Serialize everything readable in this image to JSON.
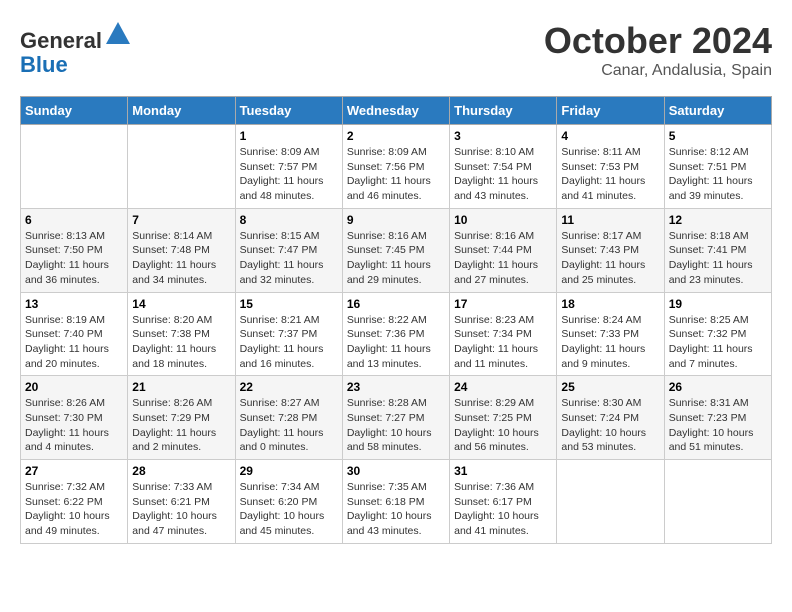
{
  "header": {
    "logo_line1": "General",
    "logo_line2": "Blue",
    "month": "October 2024",
    "location": "Canar, Andalusia, Spain"
  },
  "days_of_week": [
    "Sunday",
    "Monday",
    "Tuesday",
    "Wednesday",
    "Thursday",
    "Friday",
    "Saturday"
  ],
  "weeks": [
    [
      {
        "day": "",
        "info": ""
      },
      {
        "day": "",
        "info": ""
      },
      {
        "day": "1",
        "info": "Sunrise: 8:09 AM\nSunset: 7:57 PM\nDaylight: 11 hours and 48 minutes."
      },
      {
        "day": "2",
        "info": "Sunrise: 8:09 AM\nSunset: 7:56 PM\nDaylight: 11 hours and 46 minutes."
      },
      {
        "day": "3",
        "info": "Sunrise: 8:10 AM\nSunset: 7:54 PM\nDaylight: 11 hours and 43 minutes."
      },
      {
        "day": "4",
        "info": "Sunrise: 8:11 AM\nSunset: 7:53 PM\nDaylight: 11 hours and 41 minutes."
      },
      {
        "day": "5",
        "info": "Sunrise: 8:12 AM\nSunset: 7:51 PM\nDaylight: 11 hours and 39 minutes."
      }
    ],
    [
      {
        "day": "6",
        "info": "Sunrise: 8:13 AM\nSunset: 7:50 PM\nDaylight: 11 hours and 36 minutes."
      },
      {
        "day": "7",
        "info": "Sunrise: 8:14 AM\nSunset: 7:48 PM\nDaylight: 11 hours and 34 minutes."
      },
      {
        "day": "8",
        "info": "Sunrise: 8:15 AM\nSunset: 7:47 PM\nDaylight: 11 hours and 32 minutes."
      },
      {
        "day": "9",
        "info": "Sunrise: 8:16 AM\nSunset: 7:45 PM\nDaylight: 11 hours and 29 minutes."
      },
      {
        "day": "10",
        "info": "Sunrise: 8:16 AM\nSunset: 7:44 PM\nDaylight: 11 hours and 27 minutes."
      },
      {
        "day": "11",
        "info": "Sunrise: 8:17 AM\nSunset: 7:43 PM\nDaylight: 11 hours and 25 minutes."
      },
      {
        "day": "12",
        "info": "Sunrise: 8:18 AM\nSunset: 7:41 PM\nDaylight: 11 hours and 23 minutes."
      }
    ],
    [
      {
        "day": "13",
        "info": "Sunrise: 8:19 AM\nSunset: 7:40 PM\nDaylight: 11 hours and 20 minutes."
      },
      {
        "day": "14",
        "info": "Sunrise: 8:20 AM\nSunset: 7:38 PM\nDaylight: 11 hours and 18 minutes."
      },
      {
        "day": "15",
        "info": "Sunrise: 8:21 AM\nSunset: 7:37 PM\nDaylight: 11 hours and 16 minutes."
      },
      {
        "day": "16",
        "info": "Sunrise: 8:22 AM\nSunset: 7:36 PM\nDaylight: 11 hours and 13 minutes."
      },
      {
        "day": "17",
        "info": "Sunrise: 8:23 AM\nSunset: 7:34 PM\nDaylight: 11 hours and 11 minutes."
      },
      {
        "day": "18",
        "info": "Sunrise: 8:24 AM\nSunset: 7:33 PM\nDaylight: 11 hours and 9 minutes."
      },
      {
        "day": "19",
        "info": "Sunrise: 8:25 AM\nSunset: 7:32 PM\nDaylight: 11 hours and 7 minutes."
      }
    ],
    [
      {
        "day": "20",
        "info": "Sunrise: 8:26 AM\nSunset: 7:30 PM\nDaylight: 11 hours and 4 minutes."
      },
      {
        "day": "21",
        "info": "Sunrise: 8:26 AM\nSunset: 7:29 PM\nDaylight: 11 hours and 2 minutes."
      },
      {
        "day": "22",
        "info": "Sunrise: 8:27 AM\nSunset: 7:28 PM\nDaylight: 11 hours and 0 minutes."
      },
      {
        "day": "23",
        "info": "Sunrise: 8:28 AM\nSunset: 7:27 PM\nDaylight: 10 hours and 58 minutes."
      },
      {
        "day": "24",
        "info": "Sunrise: 8:29 AM\nSunset: 7:25 PM\nDaylight: 10 hours and 56 minutes."
      },
      {
        "day": "25",
        "info": "Sunrise: 8:30 AM\nSunset: 7:24 PM\nDaylight: 10 hours and 53 minutes."
      },
      {
        "day": "26",
        "info": "Sunrise: 8:31 AM\nSunset: 7:23 PM\nDaylight: 10 hours and 51 minutes."
      }
    ],
    [
      {
        "day": "27",
        "info": "Sunrise: 7:32 AM\nSunset: 6:22 PM\nDaylight: 10 hours and 49 minutes."
      },
      {
        "day": "28",
        "info": "Sunrise: 7:33 AM\nSunset: 6:21 PM\nDaylight: 10 hours and 47 minutes."
      },
      {
        "day": "29",
        "info": "Sunrise: 7:34 AM\nSunset: 6:20 PM\nDaylight: 10 hours and 45 minutes."
      },
      {
        "day": "30",
        "info": "Sunrise: 7:35 AM\nSunset: 6:18 PM\nDaylight: 10 hours and 43 minutes."
      },
      {
        "day": "31",
        "info": "Sunrise: 7:36 AM\nSunset: 6:17 PM\nDaylight: 10 hours and 41 minutes."
      },
      {
        "day": "",
        "info": ""
      },
      {
        "day": "",
        "info": ""
      }
    ]
  ]
}
